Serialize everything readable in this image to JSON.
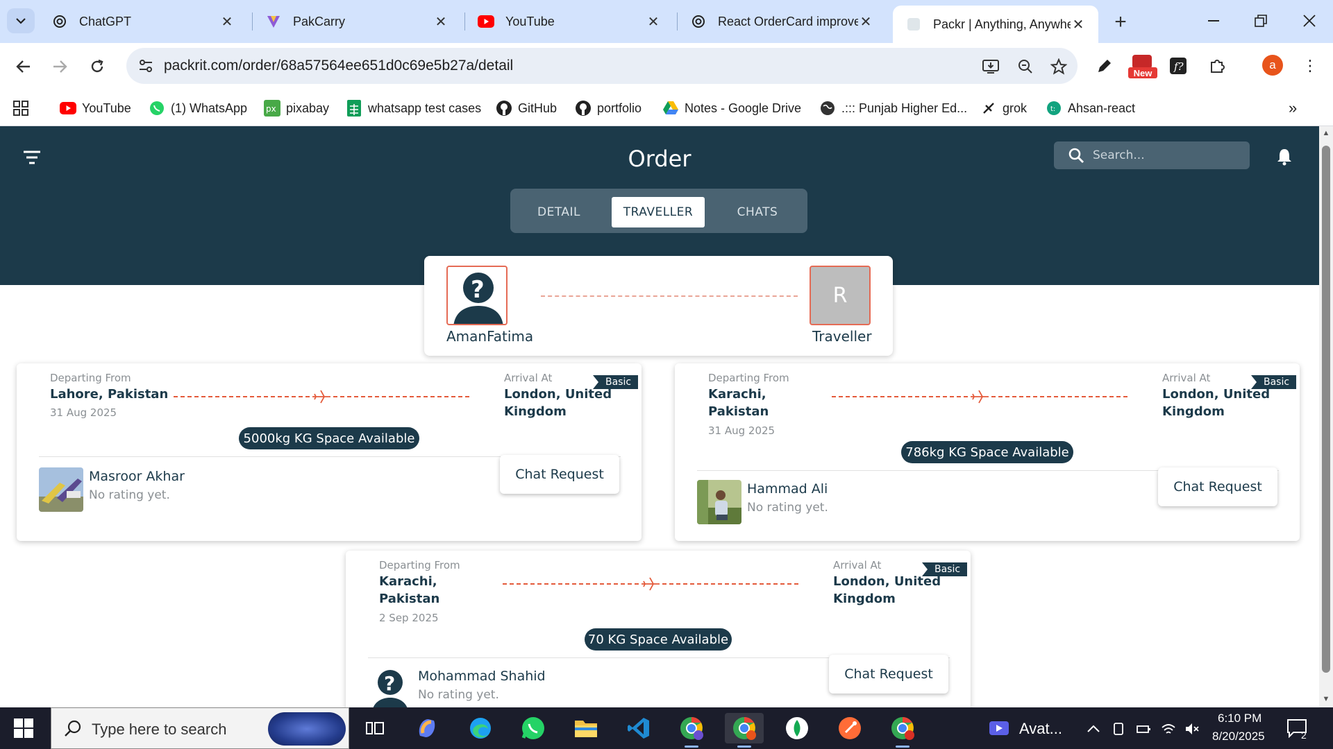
{
  "browser": {
    "tabs": [
      {
        "title": "ChatGPT",
        "icon": "chatgpt-icon"
      },
      {
        "title": "PakCarry",
        "icon": "pakcarry-icon"
      },
      {
        "title": "YouTube",
        "icon": "youtube-icon"
      },
      {
        "title": "React OrderCard improve",
        "icon": "chatgpt-icon"
      },
      {
        "title": "Packr | Anything, Anywhe",
        "icon": "packr-icon",
        "active": true
      }
    ],
    "url": "packrit.com/order/68a57564ee651d0c69e5b27a/detail",
    "new_badge": "New",
    "profile_initial": "a",
    "bookmarks": [
      {
        "label": "YouTube",
        "icon": "youtube-icon"
      },
      {
        "label": "(1) WhatsApp",
        "icon": "whatsapp-icon"
      },
      {
        "label": "pixabay",
        "icon": "pixabay-icon"
      },
      {
        "label": "whatsapp test cases",
        "icon": "sheets-icon"
      },
      {
        "label": "GitHub",
        "icon": "github-icon"
      },
      {
        "label": "portfolio",
        "icon": "github-icon"
      },
      {
        "label": "Notes - Google Drive",
        "icon": "drive-icon"
      },
      {
        "label": ".::: Punjab Higher Ed...",
        "icon": "globe-icon"
      },
      {
        "label": "grok",
        "icon": "grok-icon"
      },
      {
        "label": "Ahsan-react",
        "icon": "site-icon"
      }
    ]
  },
  "header": {
    "title": "Order",
    "search_placeholder": "Search..."
  },
  "tabs": [
    {
      "label": "DETAIL",
      "active": false
    },
    {
      "label": "TRAVELLER",
      "active": true
    },
    {
      "label": "CHATS",
      "active": false
    }
  ],
  "summary": {
    "sender_name": "AmanFatima",
    "traveller_initial": "R",
    "traveller_label": "Traveller"
  },
  "trips": [
    {
      "departing_label": "Departing From",
      "from": "Lahore, Pakistan",
      "date": "31 Aug 2025",
      "arrival_label": "Arrival At",
      "to": "London, United Kingdom",
      "plan": "Basic",
      "space": "5000kg KG Space Available",
      "traveller": "Masroor Akhar",
      "rating": "No rating yet.",
      "button": "Chat Request"
    },
    {
      "departing_label": "Departing From",
      "from": "Karachi, Pakistan",
      "date": "31 Aug 2025",
      "arrival_label": "Arrival At",
      "to": "London, United Kingdom",
      "plan": "Basic",
      "space": "786kg KG Space Available",
      "traveller": "Hammad Ali",
      "rating": "No rating yet.",
      "button": "Chat Request"
    },
    {
      "departing_label": "Departing From",
      "from": "Karachi, Pakistan",
      "date": "2 Sep 2025",
      "arrival_label": "Arrival At",
      "to": "London, United Kingdom",
      "plan": "Basic",
      "space": "70 KG Space Available",
      "traveller": "Mohammad Shahid",
      "rating": "No rating yet.",
      "button": "Chat Request"
    }
  ],
  "taskbar": {
    "search_placeholder": "Type here to search",
    "running_app": "Avat...",
    "time": "6:10 PM",
    "date": "8/20/2025",
    "notifications": "2"
  },
  "colors": {
    "brand_dark": "#1c3a4a",
    "accent_orange": "#e45a3a"
  }
}
